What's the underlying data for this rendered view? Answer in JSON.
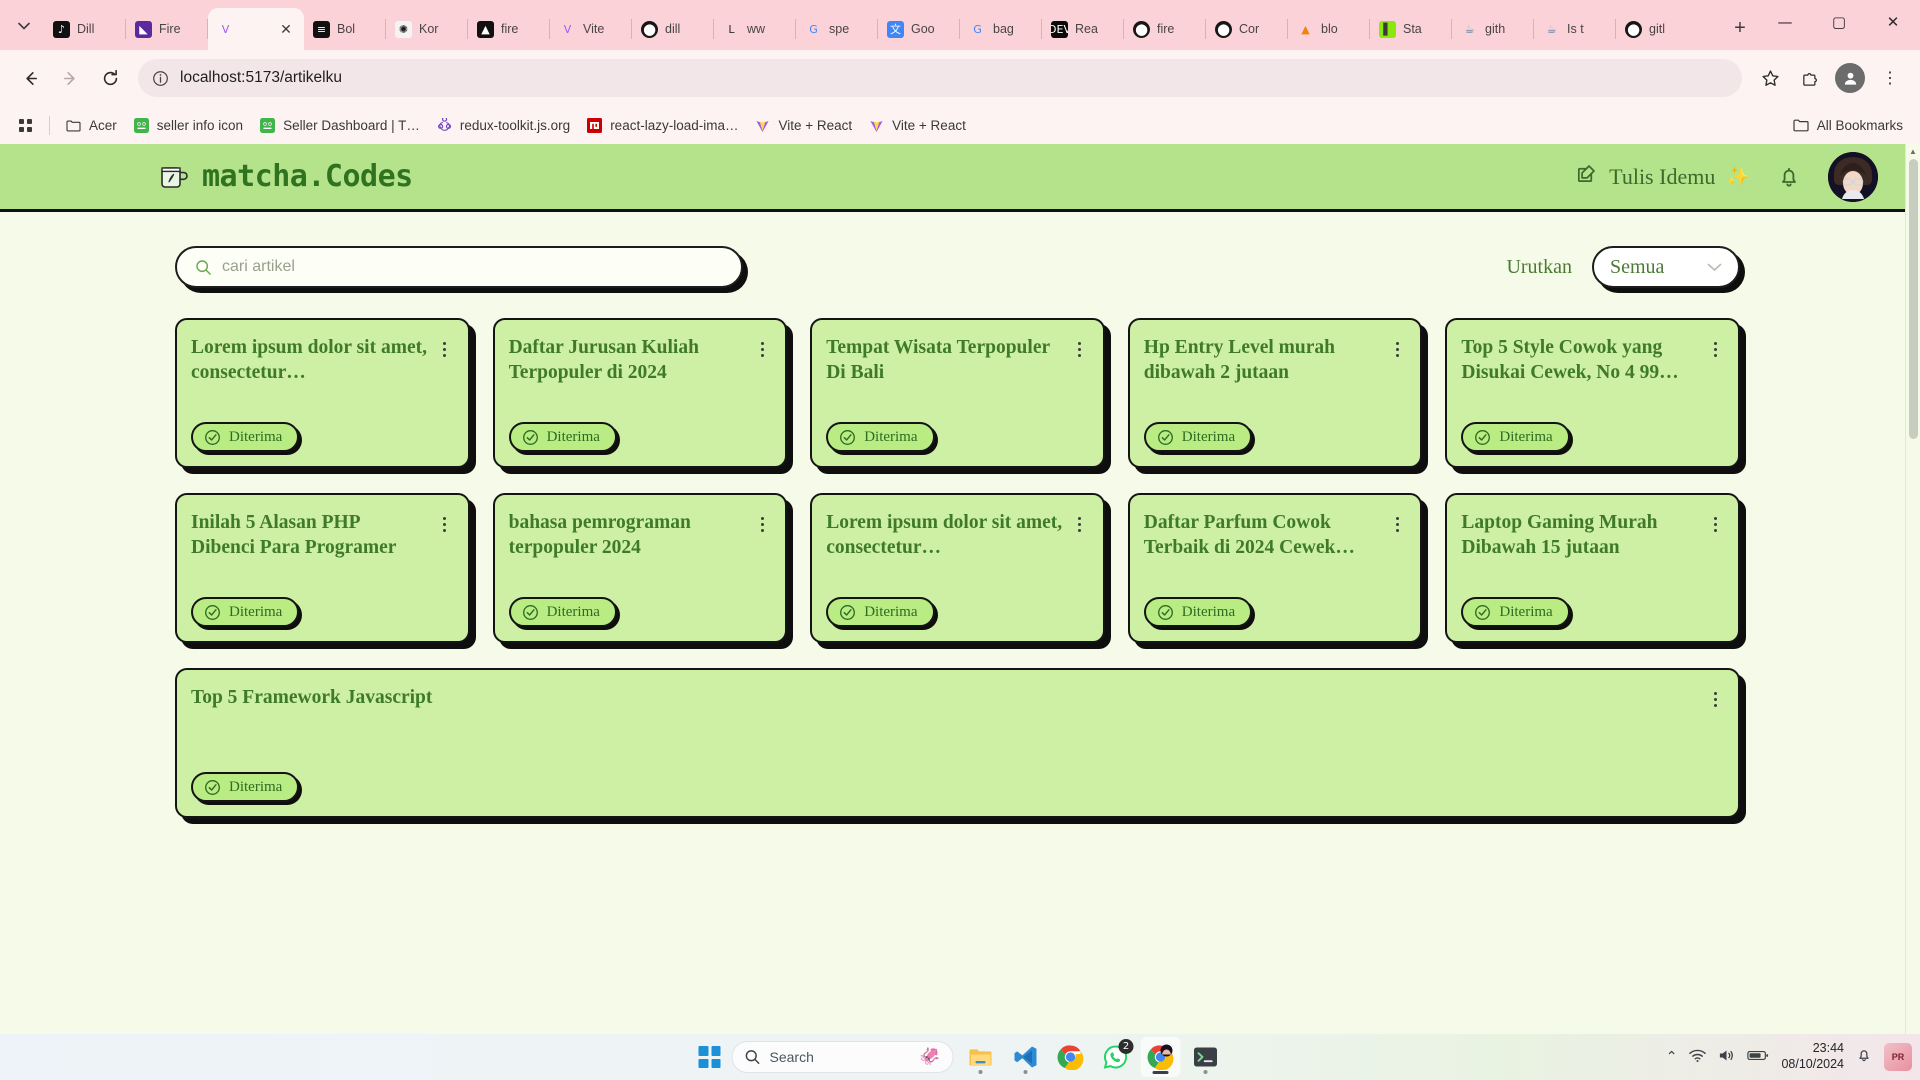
{
  "browser": {
    "tabs": [
      {
        "title": "Dill",
        "icon": "tiktok-icon",
        "glyph": "♪",
        "bg": "#111111",
        "fg": "#ffffff",
        "active": false
      },
      {
        "title": "Fire",
        "icon": "firebase-console-icon",
        "glyph": "◣",
        "bg": "#5b2a9e",
        "fg": "#ffffff",
        "active": false
      },
      {
        "title": "",
        "icon": "vite-icon",
        "glyph": "V",
        "bg": "transparent",
        "fg": "#a259f7",
        "active": true
      },
      {
        "title": "Bol",
        "icon": "bolt-icon",
        "glyph": "≡",
        "bg": "#111111",
        "fg": "#ffffff",
        "active": false
      },
      {
        "title": "Kor",
        "icon": "openai-icon",
        "glyph": "✺",
        "bg": "#f4f4f4",
        "fg": "#1a1a1a",
        "active": false
      },
      {
        "title": "fire",
        "icon": "firebase-icon",
        "glyph": "▲",
        "bg": "#111111",
        "fg": "#ffffff",
        "active": false
      },
      {
        "title": "Vite",
        "icon": "vite-icon",
        "glyph": "V",
        "bg": "transparent",
        "fg": "#a259f7",
        "active": false
      },
      {
        "title": "dill",
        "icon": "github-icon",
        "glyph": "",
        "bg": "#181717",
        "fg": "#ffffff",
        "active": false
      },
      {
        "title": "ww",
        "icon": "lucide-icon",
        "glyph": "L",
        "bg": "transparent",
        "fg": "#2b2b2b",
        "active": false
      },
      {
        "title": "spe",
        "icon": "google-icon",
        "glyph": "G",
        "bg": "transparent",
        "fg": "#4285f4",
        "active": false
      },
      {
        "title": "Goo",
        "icon": "google-translate-icon",
        "glyph": "文",
        "bg": "#4285f4",
        "fg": "#ffffff",
        "active": false
      },
      {
        "title": "bag",
        "icon": "google-icon",
        "glyph": "G",
        "bg": "transparent",
        "fg": "#4285f4",
        "active": false
      },
      {
        "title": "Rea",
        "icon": "devto-icon",
        "glyph": "DEV",
        "bg": "#0a0a0a",
        "fg": "#ffffff",
        "active": false
      },
      {
        "title": "fire",
        "icon": "github-icon",
        "glyph": "",
        "bg": "#181717",
        "fg": "#ffffff",
        "active": false
      },
      {
        "title": "Cor",
        "icon": "github-icon",
        "glyph": "",
        "bg": "#181717",
        "fg": "#ffffff",
        "active": false
      },
      {
        "title": "blo",
        "icon": "firebase-icon",
        "glyph": "▲",
        "bg": "transparent",
        "fg": "#f5820d",
        "active": false
      },
      {
        "title": "Sta",
        "icon": "stackblitz-icon",
        "glyph": "▌",
        "bg": "#8ce610",
        "fg": "#3b3b3b",
        "active": false
      },
      {
        "title": "gith",
        "icon": "java-icon",
        "glyph": "☕",
        "bg": "transparent",
        "fg": "#5382a1",
        "active": false
      },
      {
        "title": "Is t",
        "icon": "java-icon",
        "glyph": "☕",
        "bg": "transparent",
        "fg": "#5382a1",
        "active": false
      },
      {
        "title": "gitl",
        "icon": "github-icon",
        "glyph": "",
        "bg": "#181717",
        "fg": "#ffffff",
        "active": false
      }
    ],
    "new_tab_label": "+",
    "window_controls": {
      "minimize": "—",
      "maximize": "▢",
      "close": "✕"
    },
    "nav": {
      "back": "←",
      "forward": "→",
      "reload": "⟳",
      "site_info": "ⓘ"
    },
    "url": "localhost:5173/artikelku",
    "actions": {
      "bookmark": "☆",
      "extensions": "⊞",
      "profile": "A",
      "menu": "⋮"
    },
    "bookmarks": {
      "apps_label": "⠿",
      "items": [
        {
          "label": "Acer",
          "icon": "folder-icon"
        },
        {
          "label": "seller info icon",
          "icon": "favicon-green"
        },
        {
          "label": "Seller Dashboard | T…",
          "icon": "favicon-green"
        },
        {
          "label": "redux-toolkit.js.org",
          "icon": "redux-icon"
        },
        {
          "label": "react-lazy-load-ima…",
          "icon": "npm-icon"
        },
        {
          "label": "Vite + React",
          "icon": "vite-icon"
        },
        {
          "label": "Vite + React",
          "icon": "vite-icon"
        }
      ],
      "all_bookmarks_label": "All Bookmarks"
    }
  },
  "site": {
    "brand": "matcha.Codes",
    "write_button": "Tulis Idemu",
    "write_sparkle": "✨",
    "notification_icon": "bell-icon",
    "avatar_icon": "user-avatar"
  },
  "toolbar": {
    "search_placeholder": "cari artikel",
    "search_value": "",
    "sort_label": "Urutkan",
    "sort_value": "Semua",
    "sort_options": [
      "Semua"
    ]
  },
  "articles": [
    {
      "title": "Lorem ipsum dolor sit amet, consectetur…",
      "status": "Diterima"
    },
    {
      "title": "Daftar Jurusan Kuliah Terpopuler di 2024",
      "status": "Diterima"
    },
    {
      "title": "Tempat Wisata Terpopuler Di Bali",
      "status": "Diterima"
    },
    {
      "title": "Hp Entry Level murah dibawah 2 jutaan",
      "status": "Diterima"
    },
    {
      "title": "Top 5 Style Cowok yang Disukai Cewek, No 4 99…",
      "status": "Diterima"
    },
    {
      "title": "Inilah 5 Alasan PHP Dibenci Para Programer",
      "status": "Diterima"
    },
    {
      "title": "bahasa pemrograman terpopuler 2024",
      "status": "Diterima"
    },
    {
      "title": "Lorem ipsum dolor sit amet, consectetur…",
      "status": "Diterima"
    },
    {
      "title": "Daftar Parfum Cowok Terbaik di 2024 Cewek…",
      "status": "Diterima"
    },
    {
      "title": "Laptop Gaming Murah Dibawah 15 jutaan",
      "status": "Diterima"
    },
    {
      "title": "Top 5 Framework Javascript",
      "status": "Diterima"
    }
  ],
  "taskbar": {
    "start_label": "start-icon",
    "search_placeholder": "Search",
    "search_mascot": "🦑",
    "apps": [
      {
        "name": "file-explorer-icon",
        "glyph": "🗂",
        "badge": "",
        "running": true,
        "active": false
      },
      {
        "name": "vscode-icon",
        "glyph": "✂",
        "badge": "",
        "running": true,
        "active": false
      },
      {
        "name": "chrome-icon",
        "glyph": "◎",
        "badge": "",
        "running": false,
        "active": false
      },
      {
        "name": "whatsapp-icon",
        "glyph": "✆",
        "badge": "2",
        "running": false,
        "active": false
      },
      {
        "name": "chrome-active-icon",
        "glyph": "◎",
        "badge": "",
        "running": true,
        "active": true
      },
      {
        "name": "terminal-icon",
        "glyph": "❯_",
        "badge": "",
        "running": true,
        "active": false
      }
    ],
    "tray": {
      "overflow": "⌃",
      "wifi": "◗",
      "volume": "🔊",
      "battery": "▭",
      "time": "23:44",
      "date": "08/10/2024",
      "notifications": "🔔",
      "end_badge": "PR"
    }
  },
  "colors": {
    "browser_chrome": "#fbd2d8",
    "toolbar_bg": "#fdf3f3",
    "page_bg": "#f5fbe8",
    "header_green": "#b4e38b",
    "card_green": "#cef0a4",
    "chip_green": "#b9ec83",
    "brand_text": "#2f7320",
    "title_text": "#3f7a29",
    "shadow": "#0e0e0e"
  }
}
